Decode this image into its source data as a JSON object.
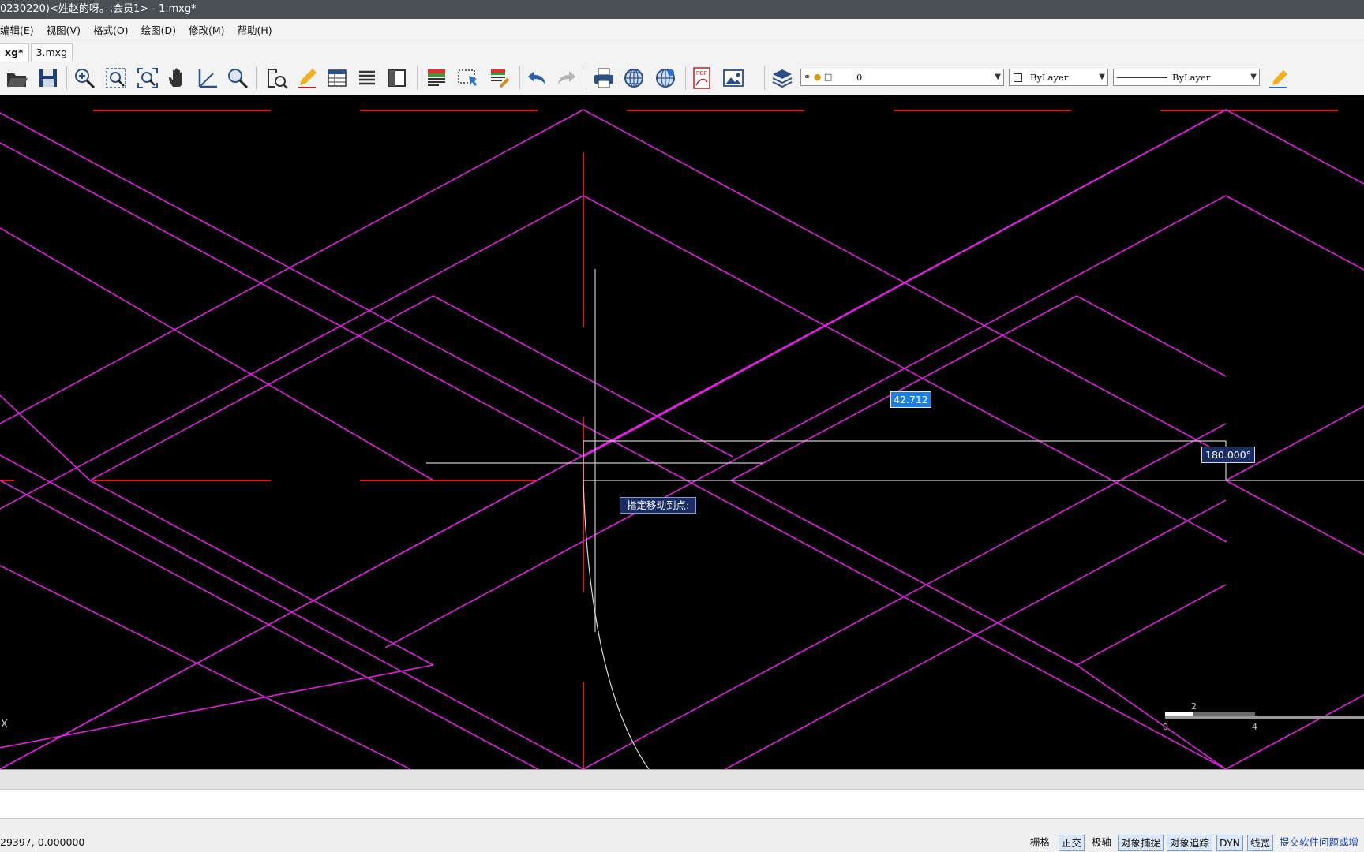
{
  "window": {
    "title": "0230220)<姓赵的呀。,会员1> - 1.mxg*"
  },
  "menu": {
    "items": [
      {
        "label": "编辑(E)"
      },
      {
        "label": "视图(V)"
      },
      {
        "label": "格式(O)"
      },
      {
        "label": "绘图(D)"
      },
      {
        "label": "修改(M)"
      },
      {
        "label": "帮助(H)"
      }
    ]
  },
  "tabs": [
    {
      "label": "xg*",
      "active": true
    },
    {
      "label": "3.mxg",
      "active": false
    }
  ],
  "toolbar": {
    "layer_value": "0",
    "color_value": "ByLayer",
    "linetype_value": "ByLayer"
  },
  "drawing": {
    "distance_input": "42.712",
    "angle_input": "180.000°",
    "prompt_tooltip": "指定移动到点:",
    "scale_label_top": "2",
    "scale_label_left": "0",
    "scale_label_right": "4",
    "axis_x_label": "X",
    "colors": {
      "magenta": "#e020e0",
      "red": "#e01818",
      "background": "#000000",
      "input_blue": "#1e7fe0"
    }
  },
  "status": {
    "coordinates": "29397,  0.000000",
    "buttons": [
      {
        "label": "栅格",
        "on": false
      },
      {
        "label": "正交",
        "on": true
      },
      {
        "label": "极轴",
        "on": false
      },
      {
        "label": "对象捕捉",
        "on": true
      },
      {
        "label": "对象追踪",
        "on": true
      },
      {
        "label": "DYN",
        "on": true
      },
      {
        "label": "线宽",
        "on": true
      }
    ],
    "feedback_link": "提交软件问题或增"
  }
}
